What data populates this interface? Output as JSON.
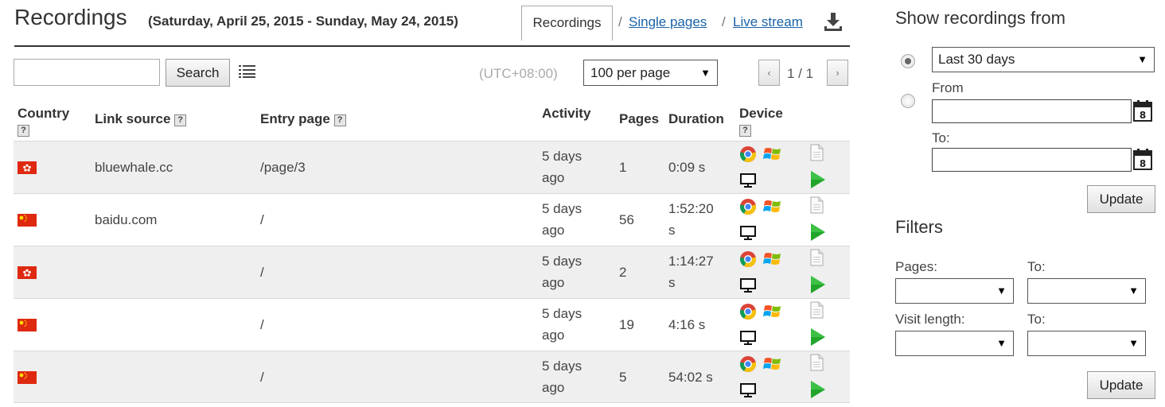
{
  "header": {
    "title": "Recordings",
    "subtitle": "(Saturday, April 25, 2015 - Sunday, May 24, 2015)",
    "active_tab": "Recordings",
    "sep1": "/",
    "link_single": "Single pages",
    "sep2": "/",
    "link_live": "Live stream"
  },
  "toolbar": {
    "search_value": "",
    "search_button": "Search",
    "timezone": "(UTC+08:00)",
    "per_page": "100 per page",
    "pager_prev": "‹",
    "pager_next": "›",
    "pager_text": "1 / 1"
  },
  "columns": {
    "country": "Country",
    "link_source": "Link source",
    "entry_page": "Entry page",
    "activity": "Activity",
    "pages": "Pages",
    "duration": "Duration",
    "device": "Device"
  },
  "rows": [
    {
      "flag": "HK",
      "link_source": "bluewhale.cc",
      "entry_page": "/page/3",
      "activity_1": "5 days",
      "activity_2": "ago",
      "pages": "1",
      "duration_1": "0:09 s",
      "duration_2": ""
    },
    {
      "flag": "CN",
      "link_source": "baidu.com",
      "entry_page": "/",
      "activity_1": "5 days",
      "activity_2": "ago",
      "pages": "56",
      "duration_1": "1:52:20",
      "duration_2": "s"
    },
    {
      "flag": "HK",
      "link_source": "",
      "entry_page": "/",
      "activity_1": "5 days",
      "activity_2": "ago",
      "pages": "2",
      "duration_1": "1:14:27",
      "duration_2": "s"
    },
    {
      "flag": "CN",
      "link_source": "",
      "entry_page": "/",
      "activity_1": "5 days",
      "activity_2": "ago",
      "pages": "19",
      "duration_1": "4:16 s",
      "duration_2": ""
    },
    {
      "flag": "CN",
      "link_source": "",
      "entry_page": "/",
      "activity_1": "5 days",
      "activity_2": "ago",
      "pages": "5",
      "duration_1": "54:02 s",
      "duration_2": ""
    }
  ],
  "panel": {
    "show_title": "Show recordings from",
    "range_value": "Last 30 days",
    "from_label": "From",
    "to_label": "To:",
    "from_value": "",
    "to_value": "",
    "update_label": "Update",
    "filters_title": "Filters",
    "pages_label": "Pages:",
    "pages_to_label": "To:",
    "visit_label": "Visit length:",
    "visit_to_label": "To:",
    "update2_label": "Update"
  },
  "colors": {
    "link": "#1a62a8",
    "row_shade": "#efefef",
    "play_green": "#22a52b"
  },
  "icons": {
    "download": "download-icon",
    "list": "list-icon",
    "chrome": "chrome-icon",
    "windows": "windows-icon",
    "desktop": "desktop-icon",
    "page": "page-icon",
    "play": "play-icon",
    "calendar": "calendar-icon"
  }
}
